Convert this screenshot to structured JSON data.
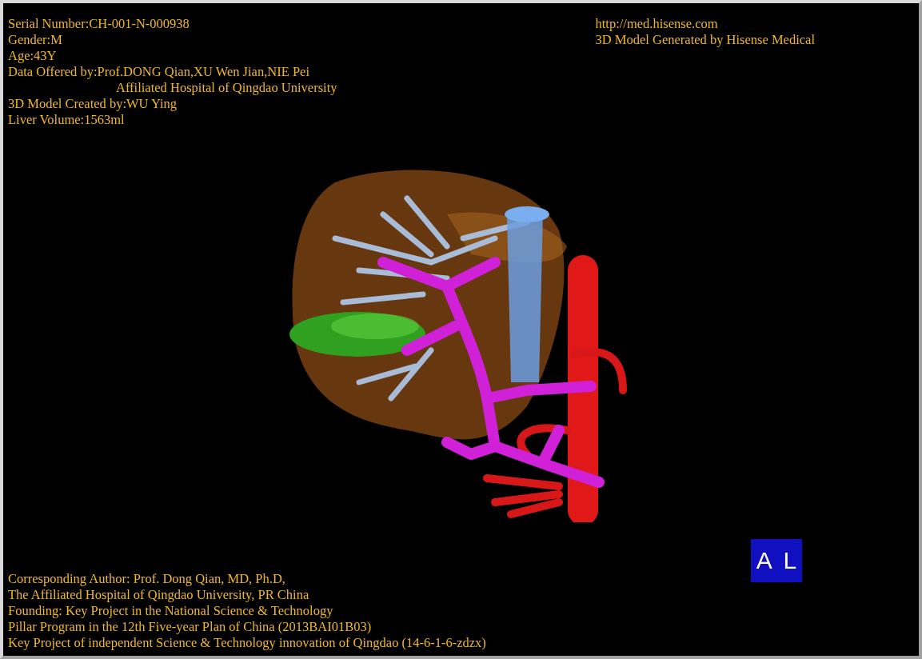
{
  "info_top_left": [
    {
      "text": "Serial Number:CH-001-N-000938",
      "kind": "line"
    },
    {
      "text": "Gender:M",
      "kind": "line"
    },
    {
      "text": "Age:43Y",
      "kind": "line"
    },
    {
      "text": "Data Offered by:Prof.DONG Qian,XU Wen Jian,NIE Pei",
      "kind": "line"
    },
    {
      "text": "Affiliated Hospital of Qingdao University",
      "kind": "continuation"
    },
    {
      "text": "3D Model Created by:WU Ying",
      "kind": "line"
    },
    {
      "text": "Liver Volume:1563ml",
      "kind": "line"
    }
  ],
  "info_top_right": [
    "http://med.hisense.com",
    "3D Model Generated by Hisense Medical"
  ],
  "info_bottom": [
    "Corresponding Author: Prof. Dong Qian, MD, Ph.D,",
    "The Affiliated Hospital of Qingdao University, PR China",
    "Founding: Key Project in the National Science & Technology",
    "Pillar Program in the 12th Five-year Plan of China (2013BAI01B03)",
    "Key Project of independent Science & Technology innovation of Qingdao (14-6-1-6-zdzx)"
  ],
  "orientation_cube": {
    "labels": [
      "A",
      "L"
    ]
  }
}
